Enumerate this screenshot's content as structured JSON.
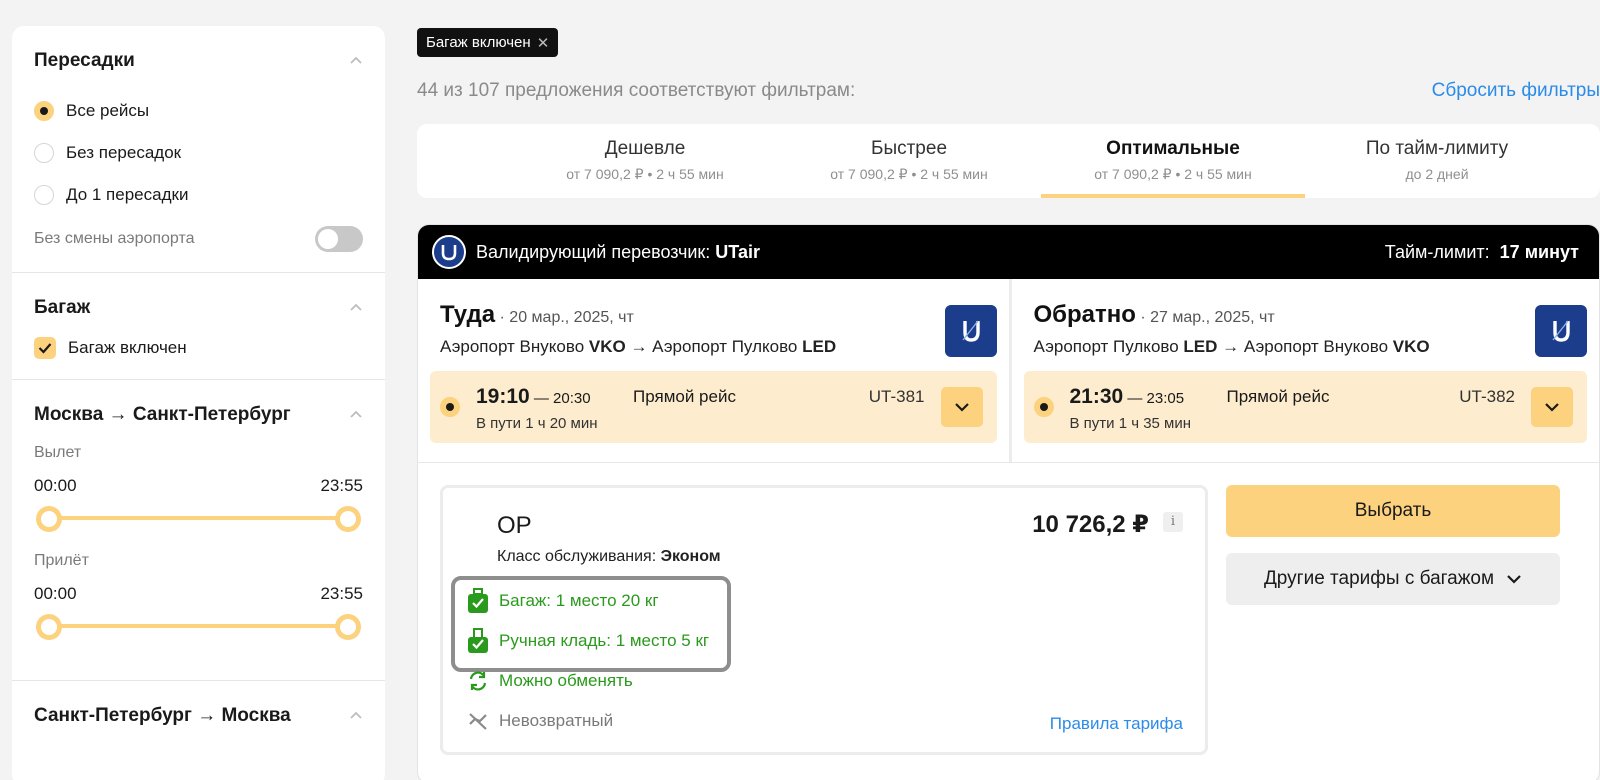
{
  "sidebar": {
    "transfers": {
      "title": "Пересадки",
      "options": [
        "Все рейсы",
        "Без пересадок",
        "До 1 пересадки"
      ],
      "selected": 0,
      "airport_toggle_label": "Без смены аэропорта"
    },
    "baggage": {
      "title": "Багаж",
      "checkbox_label": "Багаж включен"
    },
    "route1": {
      "title": "Москва → Санкт-Петербург",
      "departure_label": "Вылет",
      "departure_from": "00:00",
      "departure_to": "23:55",
      "arrival_label": "Прилёт",
      "arrival_from": "00:00",
      "arrival_to": "23:55"
    },
    "route2": {
      "title": "Санкт-Петербург → Москва"
    }
  },
  "filter_chip": {
    "label": "Багаж включен",
    "close_glyph": "✕"
  },
  "results": {
    "count_text": "44 из 107 предложения соответствуют фильтрам:",
    "reset_label": "Сбросить фильтры"
  },
  "tabs": [
    {
      "title": "Дешевле",
      "sub": "от 7 090,2 ₽ • 2 ч 55 мин"
    },
    {
      "title": "Быстрее",
      "sub": "от 7 090,2 ₽ • 2 ч 55 мин"
    },
    {
      "title": "Оптимальные",
      "sub": "от 7 090,2 ₽ • 2 ч 55 мин"
    },
    {
      "title": "По тайм-лимиту",
      "sub": "до 2 дней"
    }
  ],
  "card": {
    "carrier_prefix": "Валидирующий перевозчик: ",
    "carrier_name": "UTair",
    "limit_prefix": "Тайм-лимит: ",
    "limit_value": "17 минут",
    "legs": [
      {
        "title": "Туда",
        "date": " · 20 мар., 2025, чт",
        "from_airport": "Аэропорт Внуково ",
        "from_code": "VKO",
        "arrow": " → ",
        "to_airport": "Аэропорт Пулково ",
        "to_code": "LED",
        "dep_time": "19:10",
        "arr_time": " — 20:30",
        "duration": "В пути 1 ч 20 мин",
        "type": "Прямой рейс",
        "flight": "UT-381"
      },
      {
        "title": "Обратно",
        "date": " · 27 мар., 2025, чт",
        "from_airport": "Аэропорт Пулково ",
        "from_code": "LED",
        "arrow": " → ",
        "to_airport": "Аэропорт Внуково ",
        "to_code": "VKO",
        "dep_time": "21:30",
        "arr_time": " — 23:05",
        "duration": "В пути 1 ч 35 мин",
        "type": "Прямой рейс",
        "flight": "UT-382"
      }
    ],
    "fare": {
      "name": "OP",
      "class_prefix": "Класс обслуживания: ",
      "class_value": "Эконом",
      "price": "10 726,2 ₽",
      "info_glyph": "i",
      "features": {
        "baggage": "Багаж: 1 место 20 кг",
        "carry_on": "Ручная кладь: 1 место 5 кг",
        "exchange": "Можно обменять",
        "refund": "Невозвратный"
      },
      "rules_link": "Правила тарифа"
    },
    "select_label": "Выбрать",
    "other_fares_label": "Другие тарифы с багажом"
  },
  "colors": {
    "accent_yellow": "#fcd27f",
    "segment_bg": "#fdeccd",
    "link_blue": "#2b8be8",
    "feature_green": "#2a9a1c",
    "utair_blue": "#1b3d8c"
  }
}
